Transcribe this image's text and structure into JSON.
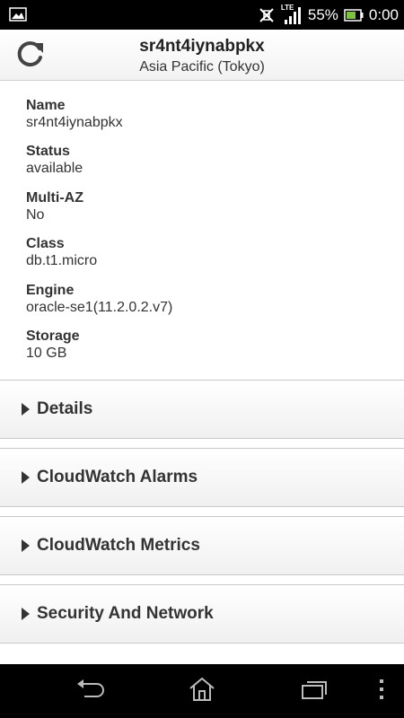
{
  "status_bar": {
    "battery_percent": "55%",
    "time": "0:00",
    "network": "LTE",
    "icons": [
      "image-icon",
      "vibrate-icon",
      "signal-icon",
      "battery-icon"
    ]
  },
  "header": {
    "title": "sr4nt4iynabpkx",
    "subtitle": "Asia Pacific (Tokyo)",
    "refresh_icon": "refresh-icon"
  },
  "info": [
    {
      "label": "Name",
      "value": "sr4nt4iynabpkx"
    },
    {
      "label": "Status",
      "value": "available"
    },
    {
      "label": "Multi-AZ",
      "value": "No"
    },
    {
      "label": "Class",
      "value": "db.t1.micro"
    },
    {
      "label": "Engine",
      "value": "oracle-se1(11.2.0.2.v7)"
    },
    {
      "label": "Storage",
      "value": "10 GB"
    }
  ],
  "sections": [
    {
      "label": "Details"
    },
    {
      "label": "CloudWatch Alarms"
    },
    {
      "label": "CloudWatch Metrics"
    },
    {
      "label": "Security And Network"
    }
  ],
  "nav": {
    "icons": [
      "back-icon",
      "home-icon",
      "recent-apps-icon",
      "overflow-menu-icon"
    ]
  },
  "colors": {
    "status_bar_bg": "#000000",
    "battery_green": "#7ec242",
    "section_text": "#333333"
  }
}
